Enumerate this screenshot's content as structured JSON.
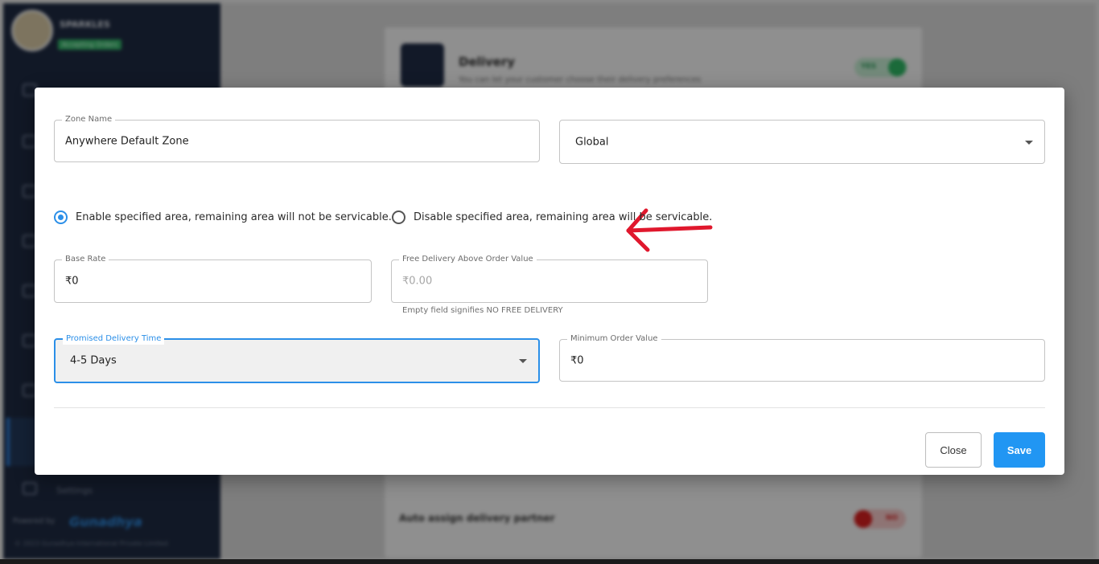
{
  "background": {
    "store_name": "SPARKLES",
    "store_badge": "Accepting Orders",
    "delivery_title": "Delivery",
    "delivery_subtitle": "You can let your customer choose their delivery preferences",
    "delivery_toggle_label": "YES",
    "auto_assign_label": "Auto assign delivery partner",
    "auto_assign_toggle_label": "NO",
    "sidebar_settings_label": "Settings",
    "powered_by_label": "Powered by",
    "powered_by_brand": "Gunadhya",
    "copyright": "© 2023 Gunadhya International Private Limited"
  },
  "modal": {
    "zone_name": {
      "label": "Zone Name",
      "value": "Anywhere Default Zone"
    },
    "zone_type": {
      "value": "Global"
    },
    "area_options": [
      {
        "label": "Enable specified area, remaining area will not be servicable.",
        "checked": true
      },
      {
        "label": "Disable specified area, remaining area will be servicable.",
        "checked": false
      }
    ],
    "base_rate": {
      "label": "Base Rate",
      "value": "₹0"
    },
    "free_delivery": {
      "label": "Free Delivery Above Order Value",
      "placeholder": "₹0.00",
      "helper": "Empty field signifies NO FREE DELIVERY"
    },
    "promised_time": {
      "label": "Promised Delivery Time",
      "value": "4-5 Days"
    },
    "min_order": {
      "label": "Minimum Order Value",
      "value": "₹0"
    },
    "close_label": "Close",
    "save_label": "Save"
  },
  "colors": {
    "accent": "#2196f3",
    "annotation": "#e0182d",
    "sidebar": "#1e2a42"
  },
  "icons": [
    "dropdown-caret-icon",
    "annotation-arrow-icon",
    "delivery-truck-icon"
  ]
}
